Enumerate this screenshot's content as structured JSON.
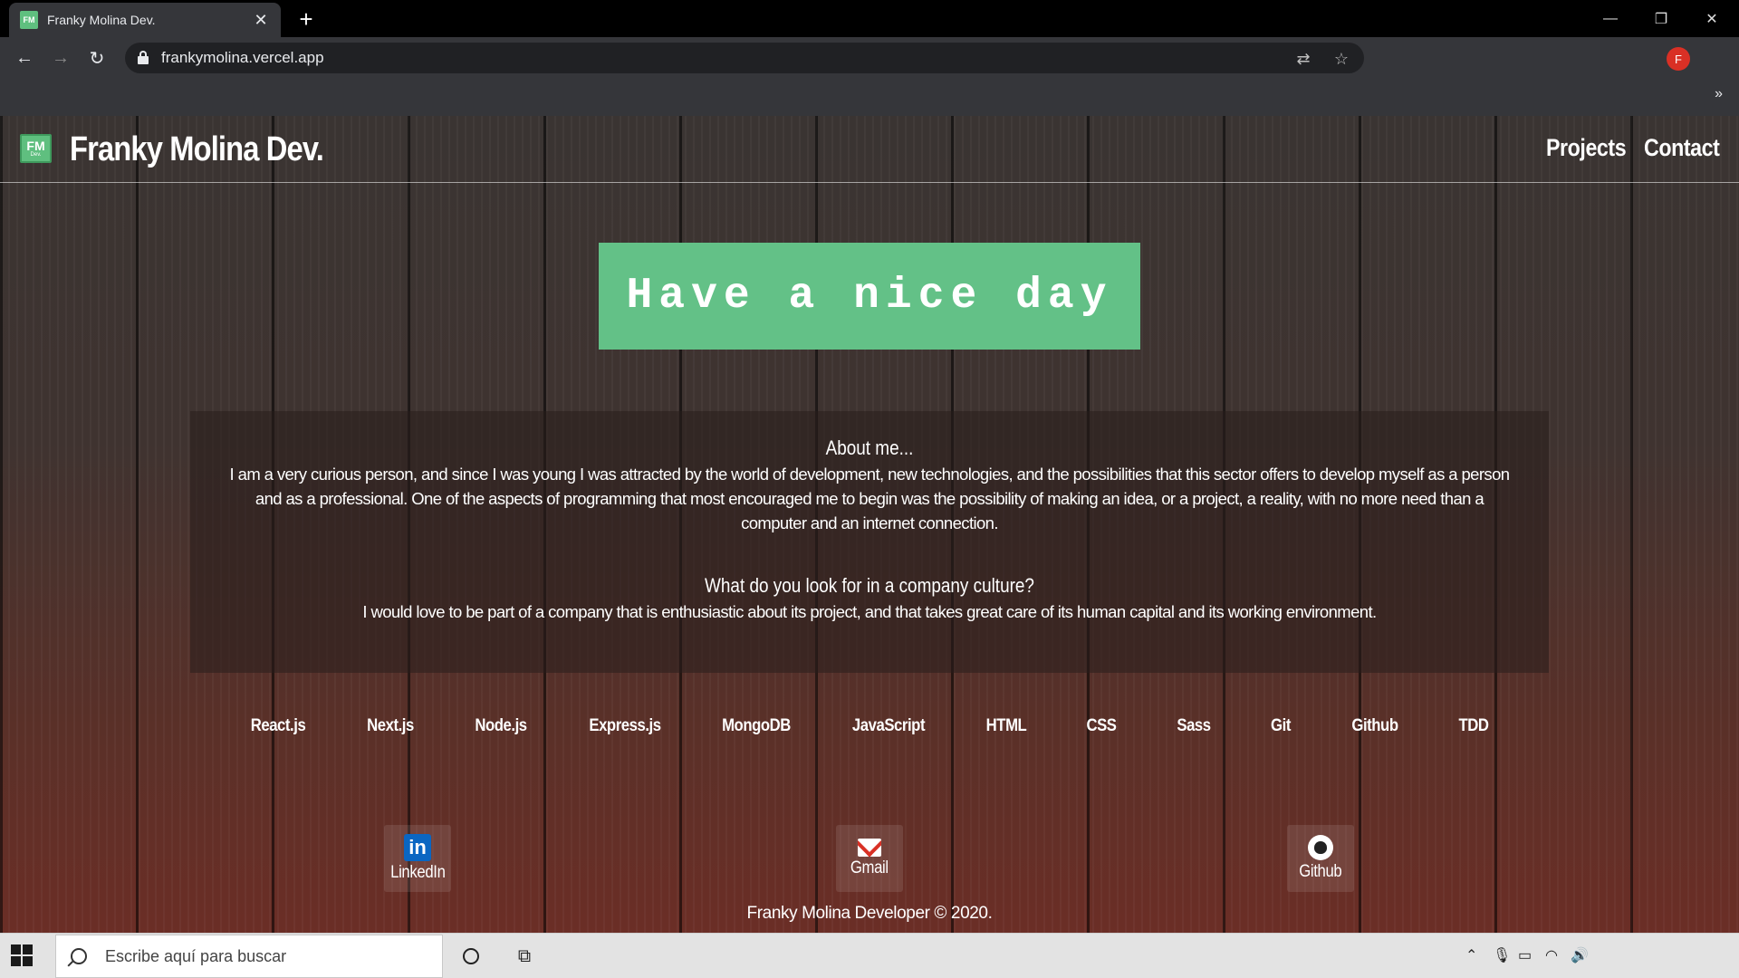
{
  "browser": {
    "tab_title": "Franky Molina Dev.",
    "favicon_text": "FM",
    "url": "frankymolina.vercel.app",
    "profile_initial": "F"
  },
  "site": {
    "logo_text": "FM",
    "logo_subtext": "Dev.",
    "title": "Franky Molina Dev.",
    "nav": [
      "Projects",
      "Contact"
    ],
    "hero": "Have a nice day",
    "about": {
      "heading": "About me...",
      "text": "I am a very curious person, and since I was young I was attracted by the world of development, new technologies, and the possibilities that this sector offers to develop myself as a person and as a professional. One of the aspects of programming that most encouraged me to begin was the possibility of making an idea, or a project, a reality, with no more need than a computer and an internet connection.",
      "culture_heading": "What do you look for in a company culture?",
      "culture_text": "I would love to be part of a company that is enthusiastic about its project, and that takes great care of its human capital and its working environment."
    },
    "skills": [
      "React.js",
      "Next.js",
      "Node.js",
      "Express.js",
      "MongoDB",
      "JavaScript",
      "HTML",
      "CSS",
      "Sass",
      "Git",
      "Github",
      "TDD"
    ],
    "social": {
      "linkedin": "LinkedIn",
      "gmail": "Gmail",
      "github": "Github",
      "linkedin_icon_text": "in"
    },
    "footer": "Franky Molina Developer © 2020.",
    "accent_color": "#63c187"
  },
  "taskbar": {
    "search_placeholder": "Escribe aquí para buscar"
  }
}
